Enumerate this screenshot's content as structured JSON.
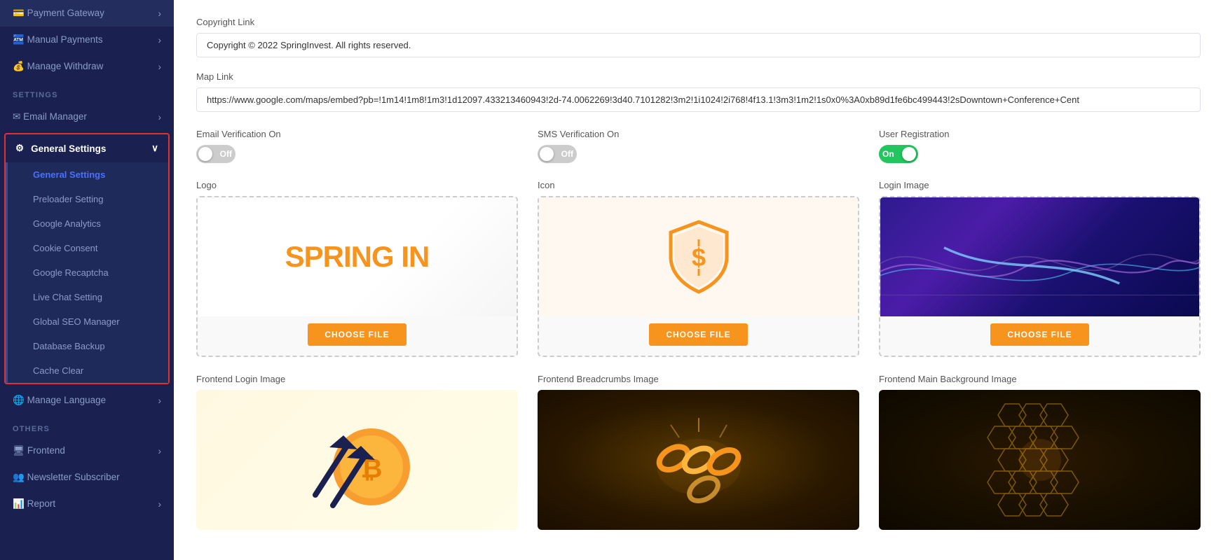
{
  "sidebar": {
    "top_items": [
      {
        "id": "payment-gateway",
        "label": "Payment Gateway",
        "icon": "💳",
        "has_arrow": true
      },
      {
        "id": "manual-payments",
        "label": "Manual Payments",
        "icon": "🏧",
        "has_arrow": true
      },
      {
        "id": "manage-withdraw",
        "label": "Manage Withdraw",
        "icon": "💰",
        "has_arrow": true
      }
    ],
    "settings_label": "SETTINGS",
    "email_manager": {
      "label": "Email Manager",
      "icon": "✉️",
      "has_arrow": true
    },
    "general_settings": {
      "label": "General Settings",
      "icon": "⚙️",
      "has_arrow": true,
      "sub_items": [
        {
          "id": "general-settings-sub",
          "label": "General Settings",
          "active": true
        },
        {
          "id": "preloader-setting",
          "label": "Preloader Setting"
        },
        {
          "id": "google-analytics",
          "label": "Google Analytics"
        },
        {
          "id": "cookie-consent",
          "label": "Cookie Consent"
        },
        {
          "id": "google-recaptcha",
          "label": "Google Recaptcha"
        },
        {
          "id": "live-chat-setting",
          "label": "Live Chat Setting"
        },
        {
          "id": "global-seo-manager",
          "label": "Global SEO Manager"
        },
        {
          "id": "database-backup",
          "label": "Database Backup"
        },
        {
          "id": "cache-clear",
          "label": "Cache Clear"
        }
      ]
    },
    "manage_language": {
      "label": "Manage Language",
      "icon": "🌐",
      "has_arrow": true
    },
    "others_label": "OTHERS",
    "others_items": [
      {
        "id": "frontend",
        "label": "Frontend",
        "icon": "🖥",
        "has_arrow": true
      },
      {
        "id": "newsletter-subscriber",
        "label": "Newsletter Subscriber",
        "icon": "👥",
        "has_arrow": false
      },
      {
        "id": "report",
        "label": "Report",
        "icon": "📊",
        "has_arrow": true
      }
    ]
  },
  "main": {
    "copyright_label": "Copyright Link",
    "copyright_value": "Copyright © 2022 SpringInvest. All rights reserved.",
    "map_label": "Map Link",
    "map_value": "https://www.google.com/maps/embed?pb=!1m14!1m8!1m3!1d12097.433213460943!2d-74.0062269!3d40.7101282!3m2!1i1024!2i768!4f13.1!3m3!1m2!1s0x0%3A0xb89d1fe6bc499443!2sDowntown+Conference+Cent",
    "email_verification_label": "Email Verification On",
    "email_verification_state": "Off",
    "sms_verification_label": "SMS Verification On",
    "sms_verification_state": "Off",
    "user_registration_label": "User Registration",
    "user_registration_state": "On",
    "logo_label": "Logo",
    "logo_text": "SPRING IN",
    "choose_file_label": "CHOOSE FILE",
    "icon_label": "Icon",
    "login_image_label": "Login Image",
    "frontend_login_label": "Frontend Login Image",
    "frontend_breadcrumbs_label": "Frontend Breadcrumbs Image",
    "frontend_main_bg_label": "Frontend Main Background Image"
  }
}
